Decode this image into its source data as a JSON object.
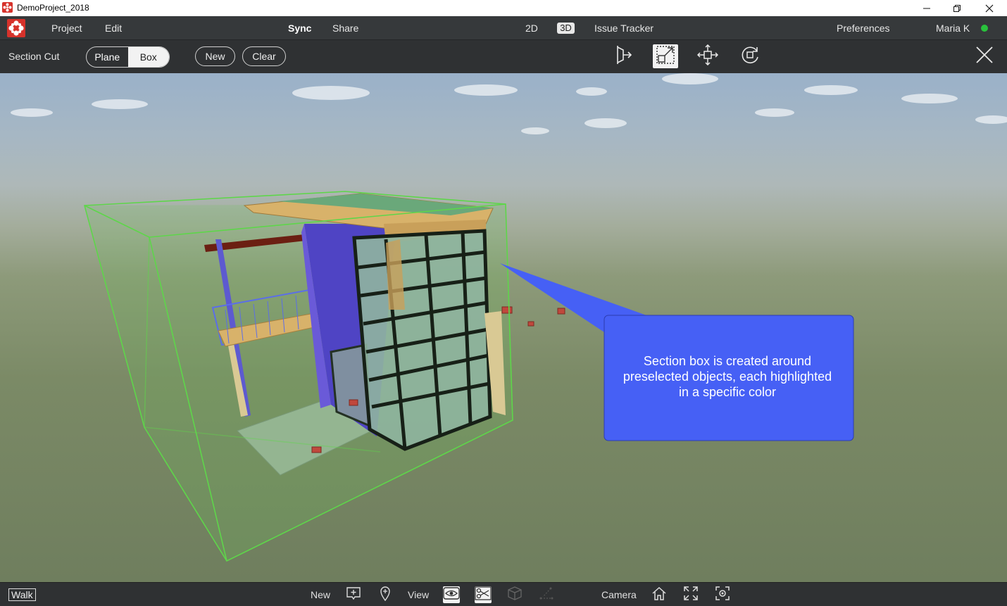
{
  "window": {
    "title": "DemoProject_2018"
  },
  "menu": {
    "project": "Project",
    "edit": "Edit",
    "sync": "Sync",
    "share": "Share",
    "view_2d": "2D",
    "view_3d": "3D",
    "issue_tracker": "Issue Tracker",
    "preferences": "Preferences",
    "user": "Maria K",
    "status_color": "#29c23c"
  },
  "section_toolbar": {
    "label": "Section Cut",
    "mode_plane": "Plane",
    "mode_box": "Box",
    "active_mode": "Box",
    "new_button": "New",
    "clear_button": "Clear",
    "tools": [
      "cut-plane-icon",
      "resize-box-icon",
      "move-icon",
      "rotate-icon"
    ],
    "active_tool": "resize-box-icon"
  },
  "viewport": {
    "callout_text": "Section box is created around preselected objects, each highlighted in a specific color",
    "callout_color": "#4660f5",
    "section_box_color": "#5ed64a"
  },
  "bottom_bar": {
    "walk": "Walk",
    "new_label": "New",
    "view_label": "View",
    "camera_label": "Camera"
  }
}
